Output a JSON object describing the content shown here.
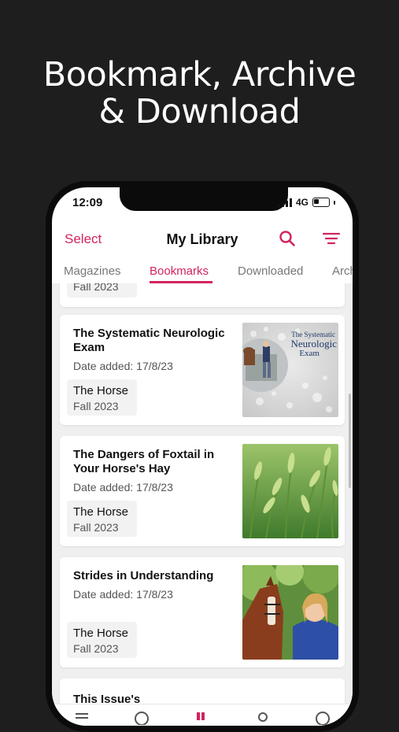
{
  "headline": {
    "line1": "Bookmark, Archive",
    "line2": "& Download"
  },
  "status": {
    "time": "12:09",
    "network": "4G"
  },
  "navbar": {
    "select_label": "Select",
    "title": "My Library",
    "icons": [
      "search-icon",
      "sort-icon"
    ]
  },
  "tabs": [
    {
      "label": "Magazines"
    },
    {
      "label": "Bookmarks"
    },
    {
      "label": "Downloaded"
    },
    {
      "label": "Archived"
    }
  ],
  "active_tab": "Bookmarks",
  "partial_top_card": {
    "issue": "Fall 2023"
  },
  "cards": [
    {
      "title": "The Systematic Neurologic Exam",
      "date": "Date added: 17/8/23",
      "publication": "The Horse",
      "issue": "Fall 2023",
      "thumb_text": "The Systematic Neurologic Exam"
    },
    {
      "title": "The Dangers of Foxtail in Your Horse's Hay",
      "date": "Date added: 17/8/23",
      "publication": "The Horse",
      "issue": "Fall 2023"
    },
    {
      "title": "Strides in Understanding",
      "date": "Date added: 17/8/23",
      "publication": "The Horse",
      "issue": "Fall 2023"
    }
  ],
  "partial_bottom_card": {
    "title": "This Issue's"
  },
  "colors": {
    "accent": "#d2245f",
    "background": "#1e1e1e"
  }
}
